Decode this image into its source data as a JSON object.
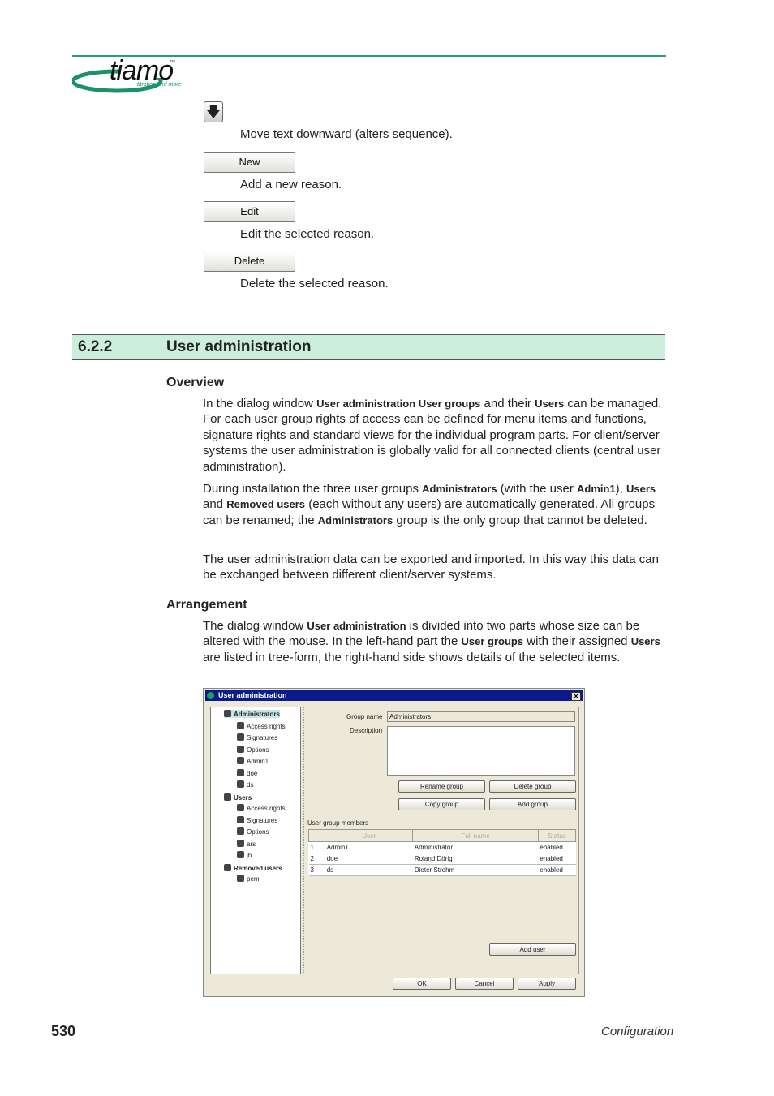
{
  "header": {
    "logo_text": "tiamo",
    "logo_tm": "™",
    "logo_tagline": "titration and more",
    "accent_color": "#2e9e72"
  },
  "buttons_list": [
    {
      "icon": "arrow-down-icon",
      "label": "",
      "description": "Move text downward (alters sequence)."
    },
    {
      "label": "New",
      "description": "Add a new reason."
    },
    {
      "label": "Edit",
      "description": "Edit the selected reason."
    },
    {
      "label": "Delete",
      "description": "Delete the selected reason."
    }
  ],
  "section": {
    "number": "6.2.2",
    "title": "User administration"
  },
  "overview": {
    "heading": "Overview",
    "paragraphs": [
      [
        {
          "t": "In the dialog window "
        },
        {
          "t": "User administration User groups",
          "b": true
        },
        {
          "t": " and their "
        },
        {
          "t": "Users",
          "b": true
        },
        {
          "t": " can be managed. For each user group rights of access can be defined for menu items and functions, signature rights and standard views for the individual program parts. For client/server systems the user administration is globally valid for all connected clients (central user administration)."
        }
      ],
      [
        {
          "t": "During installation the three user groups "
        },
        {
          "t": "Administrators",
          "b": true
        },
        {
          "t": " (with the user "
        },
        {
          "t": "Admin1",
          "b": true
        },
        {
          "t": "), "
        },
        {
          "t": "Users",
          "b": true
        },
        {
          "t": " and "
        },
        {
          "t": "Removed users",
          "b": true
        },
        {
          "t": " (each without any users) are automatically generated. All groups can be renamed; the "
        },
        {
          "t": "Administrators",
          "b": true
        },
        {
          "t": " group is the only group that cannot be deleted."
        }
      ],
      [
        {
          "t": "The user administration data can be exported and imported. In this way this data can be exchanged between different client/server systems."
        }
      ]
    ]
  },
  "arrangement": {
    "heading": "Arrangement",
    "paragraphs": [
      [
        {
          "t": "The dialog window "
        },
        {
          "t": "User administration",
          "b": true
        },
        {
          "t": " is divided into two parts whose size can be altered with the mouse. In the left-hand part the "
        },
        {
          "t": "User groups",
          "b": true
        },
        {
          "t": " with their assigned "
        },
        {
          "t": "Users",
          "b": true
        },
        {
          "t": " are listed in tree-form, the right-hand side shows details of the selected items."
        }
      ]
    ]
  },
  "dialog": {
    "title": "User administration",
    "tree": [
      {
        "label": "Administrators",
        "level": 0,
        "selected": true
      },
      {
        "label": "Access rights",
        "level": 1
      },
      {
        "label": "Signatures",
        "level": 1
      },
      {
        "label": "Options",
        "level": 1
      },
      {
        "label": "Admin1",
        "level": 1
      },
      {
        "label": "doe",
        "level": 1
      },
      {
        "label": "ds",
        "level": 1
      },
      {
        "label": "Users",
        "level": 0
      },
      {
        "label": "Access rights",
        "level": 1
      },
      {
        "label": "Signatures",
        "level": 1
      },
      {
        "label": "Options",
        "level": 1
      },
      {
        "label": "ars",
        "level": 1
      },
      {
        "label": "jb",
        "level": 1
      },
      {
        "label": "Removed users",
        "level": 0
      },
      {
        "label": "pem",
        "level": 1
      }
    ],
    "group_name_label": "Group name",
    "group_name_value": "Administrators",
    "description_label": "Description",
    "description_value": "",
    "rename_group": "Rename group",
    "delete_group": "Delete group",
    "copy_group": "Copy group",
    "add_group": "Add group",
    "members_label": "User group members",
    "columns": [
      "",
      "User",
      "Full name",
      "Status"
    ],
    "rows": [
      [
        "1",
        "Admin1",
        "Administrator",
        "enabled"
      ],
      [
        "2",
        "doe",
        "Roland Dörig",
        "enabled"
      ],
      [
        "3",
        "ds",
        "Dieter Strohm",
        "enabled"
      ]
    ],
    "add_user": "Add user",
    "ok": "OK",
    "cancel": "Cancel",
    "apply": "Apply"
  },
  "footer": {
    "page_number": "530",
    "chapter": "Configuration"
  }
}
